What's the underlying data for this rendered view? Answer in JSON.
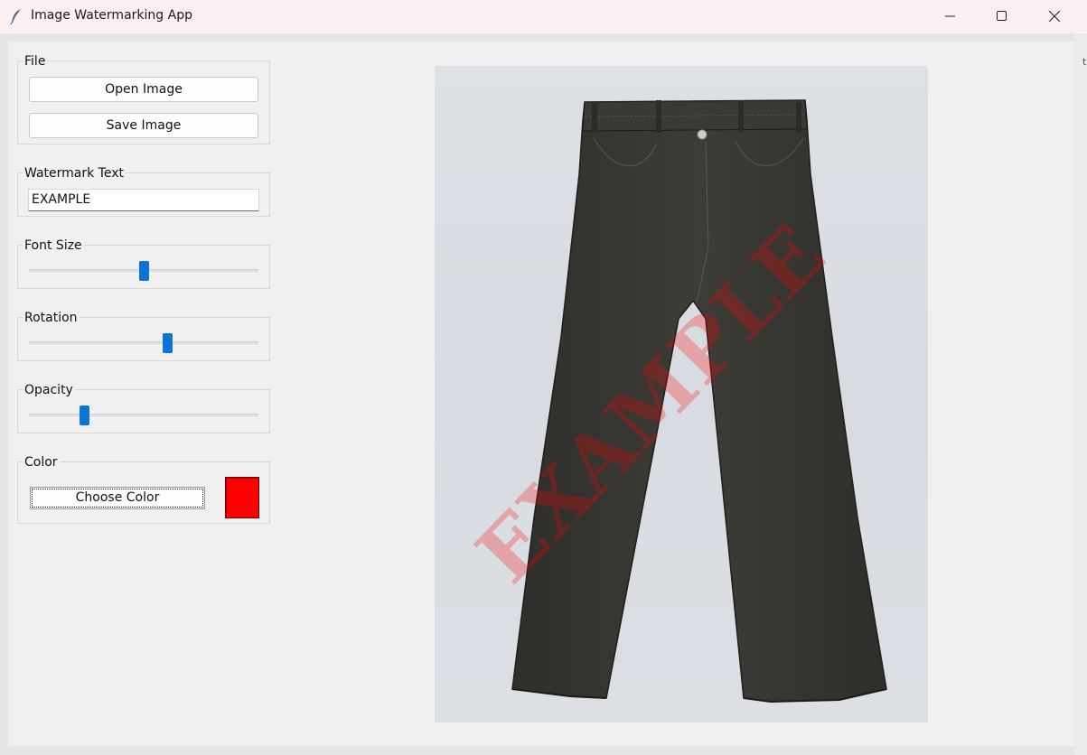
{
  "window": {
    "title": "Image Watermarking App",
    "icon": "feather-icon",
    "controls": [
      "minimize-icon",
      "maximize-icon",
      "close-icon"
    ]
  },
  "file_group": {
    "label": "File",
    "open_label": "Open Image",
    "save_label": "Save Image"
  },
  "watermark_text": {
    "label": "Watermark Text",
    "value": "EXAMPLE"
  },
  "font_size": {
    "label": "Font Size",
    "fraction": 0.5
  },
  "rotation": {
    "label": "Rotation",
    "fraction": 0.61
  },
  "opacity": {
    "label": "Opacity",
    "fraction": 0.23
  },
  "color": {
    "label": "Color",
    "button_label": "Choose Color",
    "value": "#ff0000"
  },
  "preview": {
    "watermark": "EXAMPLE",
    "watermark_color": "#ff0000",
    "subject": "black wide-leg jeans"
  },
  "colors": {
    "accent": "#0a75d6",
    "titlebar": "#faf0f2",
    "panel": "#f0f0f0"
  }
}
